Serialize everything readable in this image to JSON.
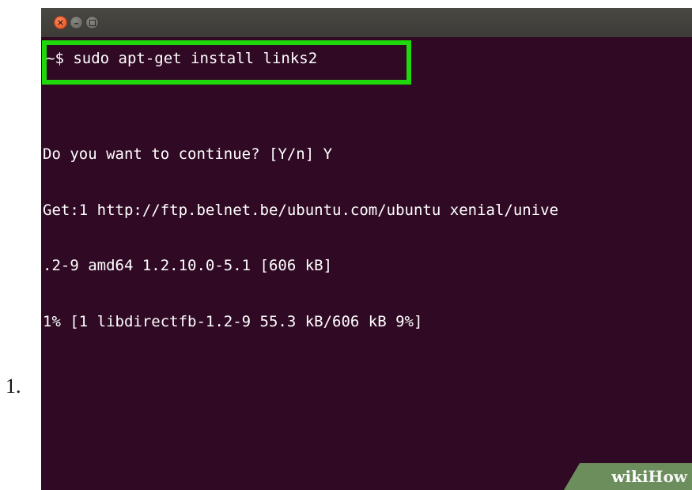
{
  "step": {
    "number": "1."
  },
  "terminal": {
    "title_bar": {
      "close_glyph": "×",
      "minimize_glyph": "–"
    },
    "command": "~$ sudo apt-get install links2",
    "output_lines": [
      "Do you want to continue? [Y/n] Y",
      "Get:1 http://ftp.belnet.be/ubuntu.com/ubuntu xenial/unive",
      ".2-9 amd64 1.2.10.0-5.1 [606 kB]",
      "1% [1 libdirectfb-1.2-9 55.3 kB/606 kB 9%]"
    ]
  },
  "watermark": {
    "wiki": "wiki",
    "how": "How"
  },
  "colors": {
    "terminal_background": "#300a24",
    "highlight_border": "#1fd80c",
    "title_bar": "#3c3b37",
    "close_button": "#e0511c",
    "watermark_background": "#6c8e5d"
  },
  "icons": {
    "close": "close-icon",
    "minimize": "minimize-icon",
    "maximize": "maximize-icon"
  }
}
